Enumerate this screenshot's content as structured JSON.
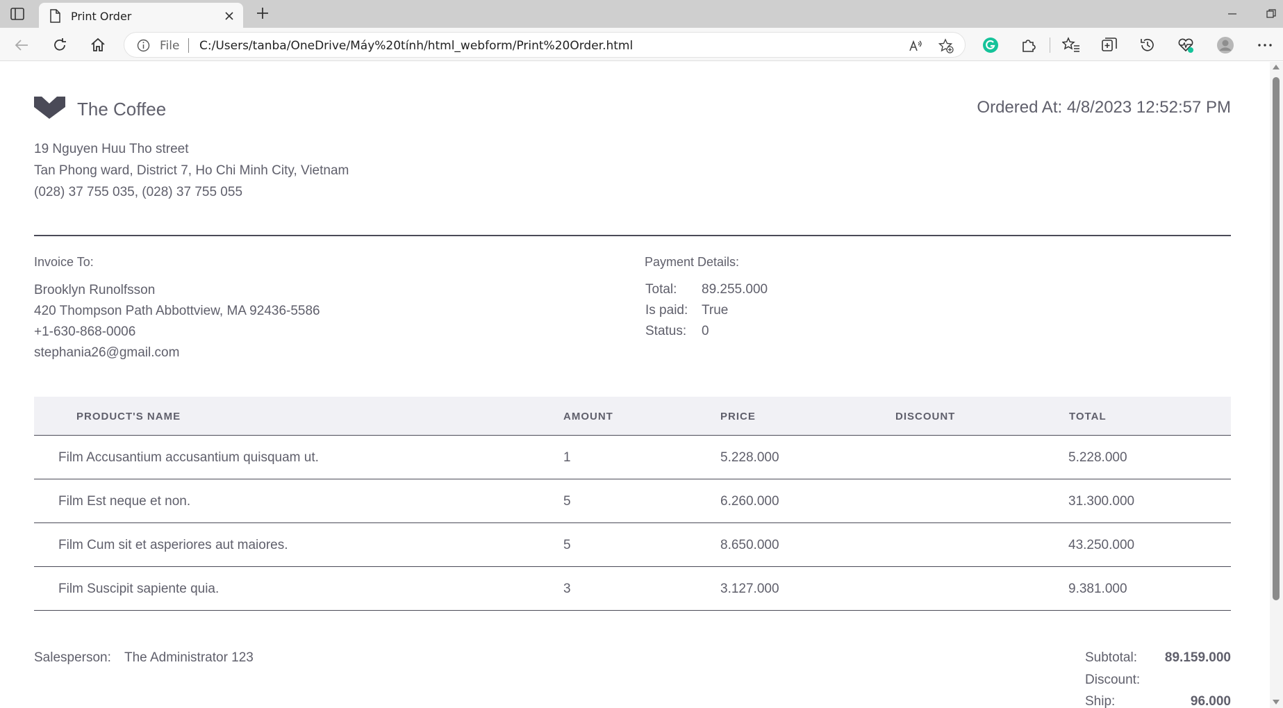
{
  "browser": {
    "tab_title": "Print Order",
    "address_scheme": "File",
    "address_url": "C:/Users/tanba/OneDrive/Máy%20tính/html_webform/Print%20Order.html"
  },
  "store": {
    "name": "The Coffee",
    "address_lines": [
      "19 Nguyen Huu Tho street",
      "Tan Phong ward, District 7, Ho Chi Minh City, Vietnam",
      "(028) 37 755 035, (028) 37 755 055"
    ]
  },
  "order": {
    "ordered_at": "Ordered At: 4/8/2023 12:52:57 PM"
  },
  "invoice_to": {
    "label": "Invoice To:",
    "name": "Brooklyn Runolfsson",
    "address": "420 Thompson Path Abbottview, MA 92436-5586",
    "phone": "+1-630-868-0006",
    "email": "stephania26@gmail.com"
  },
  "payment": {
    "label": "Payment Details:",
    "rows": [
      {
        "key": "Total:",
        "value": "89.255.000"
      },
      {
        "key": "Is paid:",
        "value": "True"
      },
      {
        "key": "Status:",
        "value": "0"
      }
    ]
  },
  "items": {
    "columns": [
      "PRODUCT'S NAME",
      "AMOUNT",
      "PRICE",
      "DISCOUNT",
      "TOTAL"
    ],
    "rows": [
      {
        "name": "Film Accusantium accusantium quisquam ut.",
        "amount": "1",
        "price": "5.228.000",
        "discount": "",
        "total": "5.228.000"
      },
      {
        "name": "Film Est neque et non.",
        "amount": "5",
        "price": "6.260.000",
        "discount": "",
        "total": "31.300.000"
      },
      {
        "name": "Film Cum sit et asperiores aut maiores.",
        "amount": "5",
        "price": "8.650.000",
        "discount": "",
        "total": "43.250.000"
      },
      {
        "name": "Film Suscipit sapiente quia.",
        "amount": "3",
        "price": "3.127.000",
        "discount": "",
        "total": "9.381.000"
      }
    ]
  },
  "salesperson": {
    "label": "Salesperson:",
    "name": "The Administrator 123"
  },
  "summary": [
    {
      "label": "Subtotal:",
      "value": "89.159.000"
    },
    {
      "label": "Discount:",
      "value": ""
    },
    {
      "label": "Ship:",
      "value": "96.000"
    }
  ],
  "icons": {
    "tab_actions": "tab-actions-icon",
    "page": "page-icon",
    "close": "close-icon",
    "new_tab": "plus-icon",
    "back": "back-arrow-icon",
    "refresh": "refresh-icon",
    "home": "home-icon",
    "info": "info-icon",
    "read_aloud": "read-aloud-icon",
    "favorite_add": "favorite-add-icon",
    "grammarly": "grammarly-icon",
    "extensions": "puzzle-icon",
    "favorites": "favorites-icon",
    "collections": "collections-icon",
    "history": "history-icon",
    "performance": "heart-pulse-icon",
    "profile": "profile-icon",
    "more": "more-icon"
  },
  "colors": {
    "text": "#5f5f6b",
    "rule": "#4a4a57",
    "table_header_bg": "#f1f1f5",
    "grammarly_green": "#15c39a"
  }
}
